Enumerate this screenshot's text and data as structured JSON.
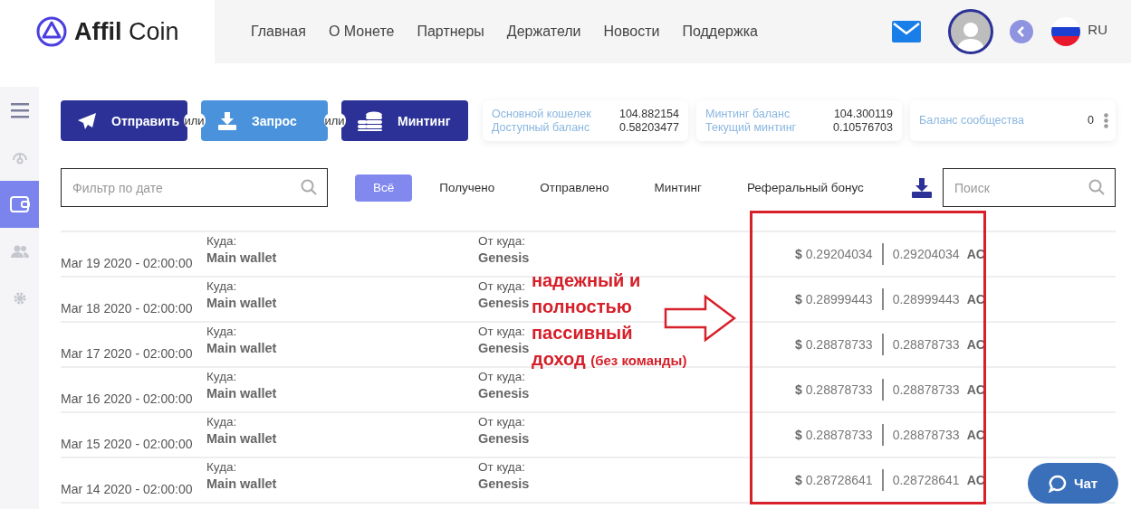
{
  "header": {
    "logo": {
      "name": "Affil",
      "suffix": "Coin"
    },
    "nav": [
      {
        "label": "Главная"
      },
      {
        "label": "О Монете"
      },
      {
        "label": "Партнеры"
      },
      {
        "label": "Держатели"
      },
      {
        "label": "Новости"
      },
      {
        "label": "Поддержка"
      }
    ],
    "language": "RU"
  },
  "sidebar": {
    "items": [
      {
        "kind": "menu",
        "selected": false
      },
      {
        "kind": "gauge",
        "selected": false
      },
      {
        "kind": "wallet",
        "selected": true
      },
      {
        "kind": "people",
        "selected": false
      },
      {
        "kind": "settings",
        "selected": false
      }
    ]
  },
  "actions": [
    {
      "kind": "send",
      "label": "Отправить",
      "color": "#2b3196"
    },
    {
      "kind": "request",
      "label": "Запрос",
      "color": "#4a93dc"
    },
    {
      "kind": "minting",
      "label": "Минтинг",
      "color": "#2b3196"
    }
  ],
  "separators": [
    "или",
    "или"
  ],
  "balances": [
    {
      "rows": [
        {
          "label": "Основной кошелек",
          "value": "104.882154"
        },
        {
          "label": "Доступный баланс",
          "value": "0.58203477"
        }
      ]
    },
    {
      "rows": [
        {
          "label": "Минтинг баланс",
          "value": "104.300119"
        },
        {
          "label": "Текущий минтинг",
          "value": "0.10576703"
        }
      ]
    },
    {
      "rows": [
        {
          "label": "Баланс сообщества",
          "value": "0"
        }
      ],
      "menu": true
    }
  ],
  "date_filter": {
    "placeholder": "Фильтр по дате"
  },
  "filters": [
    {
      "label": "Всё",
      "selected": true
    },
    {
      "label": "Получено",
      "selected": false
    },
    {
      "label": "Отправлено",
      "selected": false
    },
    {
      "label": "Минтинг",
      "selected": false
    },
    {
      "label": "Реферальный бонус",
      "selected": false
    }
  ],
  "search": {
    "placeholder": "Поиск"
  },
  "transactions": [
    {
      "date": "Mar 19 2020 - 02:00:00",
      "to_label": "Куда:",
      "to": "Main wallet",
      "from_label": "От куда:",
      "from": "Genesis",
      "usd": "0.29204034",
      "amount": "0.29204034",
      "unit": "AC"
    },
    {
      "date": "Mar 18 2020 - 02:00:00",
      "to_label": "Куда:",
      "to": "Main wallet",
      "from_label": "От куда:",
      "from": "Genesis",
      "usd": "0.28999443",
      "amount": "0.28999443",
      "unit": "AC"
    },
    {
      "date": "Mar 17 2020 - 02:00:00",
      "to_label": "Куда:",
      "to": "Main wallet",
      "from_label": "От куда:",
      "from": "Genesis",
      "usd": "0.28878733",
      "amount": "0.28878733",
      "unit": "AC"
    },
    {
      "date": "Mar 16 2020 - 02:00:00",
      "to_label": "Куда:",
      "to": "Main wallet",
      "from_label": "От куда:",
      "from": "Genesis",
      "usd": "0.28878733",
      "amount": "0.28878733",
      "unit": "AC"
    },
    {
      "date": "Mar 15 2020 - 02:00:00",
      "to_label": "Куда:",
      "to": "Main wallet",
      "from_label": "От куда:",
      "from": "Genesis",
      "usd": "0.28878733",
      "amount": "0.28878733",
      "unit": "AC"
    },
    {
      "date": "Mar 14 2020 - 02:00:00",
      "to_label": "Куда:",
      "to": "Main wallet",
      "from_label": "От куда:",
      "from": "Genesis",
      "usd": "0.28728641",
      "amount": "0.28728641",
      "unit": "AC"
    }
  ],
  "currency_sign": "$",
  "annotation": {
    "lines": [
      "надежный и",
      "полностью",
      "пассивный",
      "доход"
    ],
    "note": "(без команды)"
  },
  "chat": {
    "label": "Чат"
  }
}
